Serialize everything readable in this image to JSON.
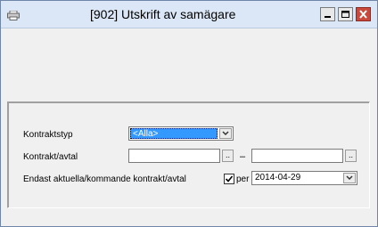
{
  "window": {
    "title": "[902]  Utskrift av samägare"
  },
  "form": {
    "kontraktstyp_label": "Kontraktstyp",
    "kontraktstyp_value": "<Alla>",
    "kontrakt_label": "Kontrakt/avtal",
    "kontrakt_from_value": "",
    "kontrakt_to_value": "",
    "dots_label": "..",
    "range_dash": "–",
    "endast_label": "Endast aktuella/kommande kontrakt/avtal",
    "endast_checked": true,
    "per_label": "per",
    "per_date": "2014-04-29"
  },
  "icons": {
    "app": "printer-icon",
    "minimize": "minimize-icon",
    "maximize": "maximize-icon",
    "close": "close-icon",
    "dropdown": "chevron-down-icon",
    "check": "check-icon"
  },
  "colors": {
    "titlebar": "#dbe7f6",
    "close": "#c94a3c",
    "selection": "#3399ff"
  }
}
